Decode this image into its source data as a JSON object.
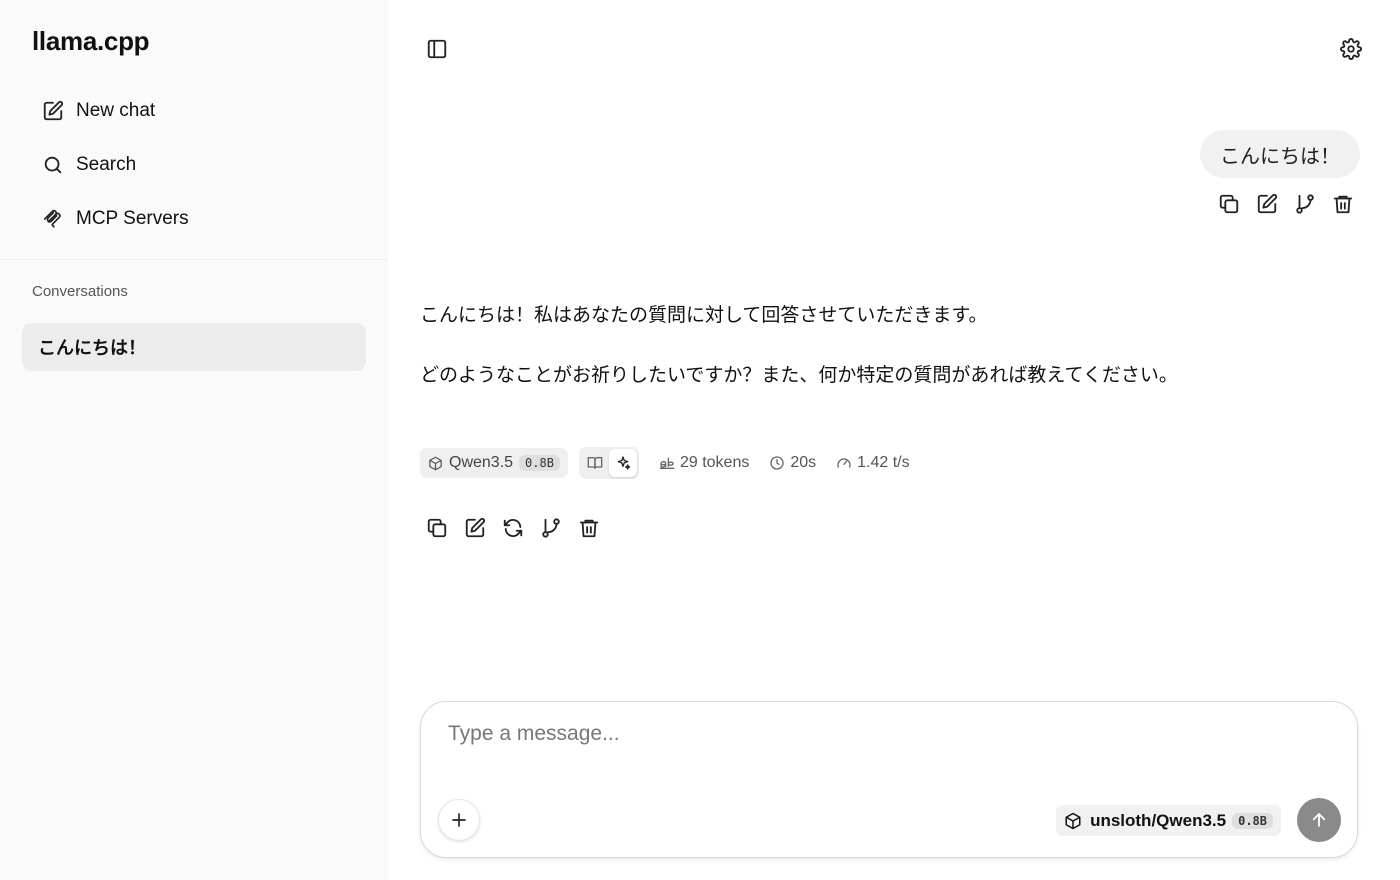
{
  "app": {
    "title": "llama.cpp"
  },
  "sidebar": {
    "nav": [
      {
        "label": "New chat",
        "icon": "edit-icon"
      },
      {
        "label": "Search",
        "icon": "search-icon"
      },
      {
        "label": "MCP Servers",
        "icon": "mcp-icon"
      }
    ],
    "conversations_heading": "Conversations",
    "conversations": [
      {
        "title": "こんにちは！",
        "active": true
      }
    ]
  },
  "header": {
    "toggle_sidebar_icon": "sidebar-toggle-icon",
    "settings_icon": "gear-icon"
  },
  "messages": {
    "user": {
      "text": "こんにちは！",
      "actions": [
        "copy-icon",
        "edit-icon",
        "branch-icon",
        "trash-icon"
      ]
    },
    "assistant": {
      "paragraphs": [
        "こんにちは！私はあなたの質問に対して回答させていただきます。",
        "どのようなことがお祈りしたいですか？また、何か特定の質問があれば教えてください。"
      ],
      "model": "Qwen3.5",
      "model_size": "0.8B",
      "tokens": "29 tokens",
      "duration": "20s",
      "speed": "1.42 t/s",
      "actions": [
        "copy-icon",
        "edit-icon",
        "regenerate-icon",
        "branch-icon",
        "trash-icon"
      ]
    }
  },
  "composer": {
    "placeholder": "Type a message...",
    "value": "",
    "model": "unsloth/Qwen3.5",
    "model_size": "0.8B"
  },
  "colors": {
    "sidebar_bg": "#fafafa",
    "active_conv_bg": "#ececec",
    "user_bubble_bg": "#f1f1f1",
    "send_button_bg": "#8a8a8a"
  }
}
